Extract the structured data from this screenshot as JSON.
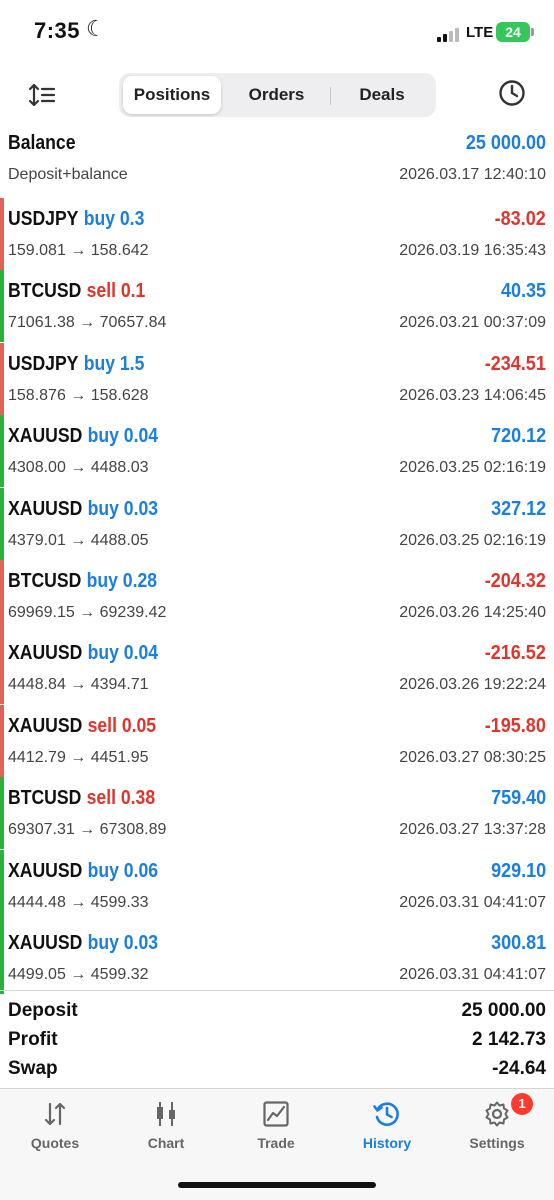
{
  "status_bar": {
    "time": "7:35",
    "network": "LTE",
    "battery": "24"
  },
  "tabs": {
    "positions": "Positions",
    "orders": "Orders",
    "deals": "Deals",
    "active": "Positions"
  },
  "balance": {
    "label": "Balance",
    "value": "25 000.00",
    "sublabel": "Deposit+balance",
    "date": "2026.03.17 12:40:10"
  },
  "deals": [
    {
      "symbol": "USDJPY",
      "side": "buy 0.3",
      "prices": "159.081 → 158.642",
      "profit": "-83.02",
      "date": "2026.03.19 16:35:43",
      "profit_sign": "negative"
    },
    {
      "symbol": "BTCUSD",
      "side": "sell 0.1",
      "prices": "71061.38 → 70657.84",
      "profit": "40.35",
      "date": "2026.03.21 00:37:09",
      "profit_sign": "positive"
    },
    {
      "symbol": "USDJPY",
      "side": "buy 1.5",
      "prices": "158.876 → 158.628",
      "profit": "-234.51",
      "date": "2026.03.23 14:06:45",
      "profit_sign": "negative"
    },
    {
      "symbol": "XAUUSD",
      "side": "buy 0.04",
      "prices": "4308.00 → 4488.03",
      "profit": "720.12",
      "date": "2026.03.25 02:16:19",
      "profit_sign": "positive"
    },
    {
      "symbol": "XAUUSD",
      "side": "buy 0.03",
      "prices": "4379.01 → 4488.05",
      "profit": "327.12",
      "date": "2026.03.25 02:16:19",
      "profit_sign": "positive"
    },
    {
      "symbol": "BTCUSD",
      "side": "buy 0.28",
      "prices": "69969.15 → 69239.42",
      "profit": "-204.32",
      "date": "2026.03.26 14:25:40",
      "profit_sign": "negative"
    },
    {
      "symbol": "XAUUSD",
      "side": "buy 0.04",
      "prices": "4448.84 → 4394.71",
      "profit": "-216.52",
      "date": "2026.03.26 19:22:24",
      "profit_sign": "negative"
    },
    {
      "symbol": "XAUUSD",
      "side": "sell 0.05",
      "prices": "4412.79 → 4451.95",
      "profit": "-195.80",
      "date": "2026.03.27 08:30:25",
      "profit_sign": "negative"
    },
    {
      "symbol": "BTCUSD",
      "side": "sell 0.38",
      "prices": "69307.31 → 67308.89",
      "profit": "759.40",
      "date": "2026.03.27 13:37:28",
      "profit_sign": "positive"
    },
    {
      "symbol": "XAUUSD",
      "side": "buy 0.06",
      "prices": "4444.48 → 4599.33",
      "profit": "929.10",
      "date": "2026.03.31 04:41:07",
      "profit_sign": "positive"
    },
    {
      "symbol": "XAUUSD",
      "side": "buy 0.03",
      "prices": "4499.05 → 4599.32",
      "profit": "300.81",
      "date": "2026.03.31 04:41:07",
      "profit_sign": "positive"
    }
  ],
  "summary": [
    {
      "label": "Deposit",
      "value": "25 000.00"
    },
    {
      "label": "Profit",
      "value": "2 142.73"
    },
    {
      "label": "Swap",
      "value": "-24.64"
    }
  ],
  "bottom_nav": {
    "quotes": "Quotes",
    "chart": "Chart",
    "trade": "Trade",
    "history": "History",
    "settings": "Settings",
    "settings_badge": "1",
    "active": "History"
  },
  "colors": {
    "accent": "#1a7fe0",
    "loss": "#e0352b",
    "gain_bar": "#2ab33a",
    "loss_bar": "#e0635a"
  }
}
